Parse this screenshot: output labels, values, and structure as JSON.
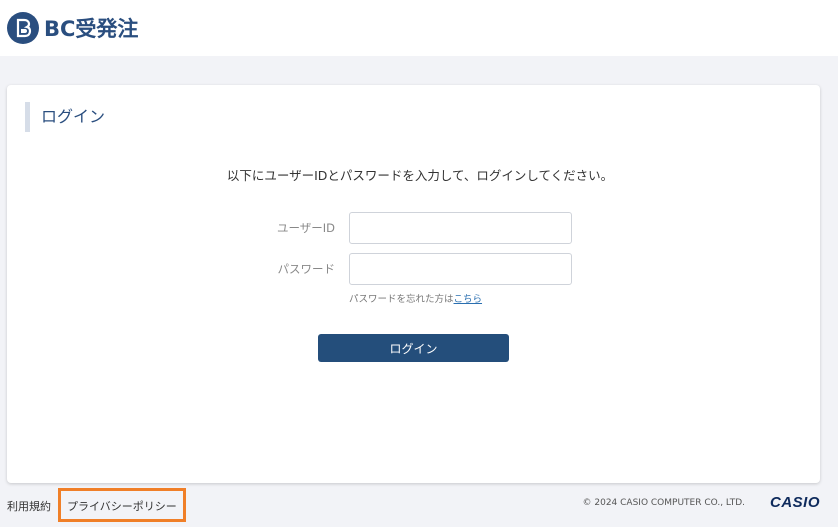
{
  "header": {
    "app_name": "BC受発注",
    "logo_mark": "b"
  },
  "login": {
    "section_title": "ログイン",
    "instruction": "以下にユーザーIDとパスワードを入力して、ログインしてください。",
    "user_id_label": "ユーザーID",
    "user_id_value": "",
    "password_label": "パスワード",
    "password_value": "",
    "forgot_prefix": "パスワードを忘れた方は",
    "forgot_link": "こちら",
    "submit_label": "ログイン"
  },
  "footer": {
    "terms_label": "利用規約",
    "privacy_label": "プライバシーポリシー",
    "copyright": "© 2024 CASIO COMPUTER CO., LTD.",
    "brand": "CASIO"
  },
  "colors": {
    "brand": "#2a4e7f",
    "button": "#244e7b",
    "highlight": "#f07f28",
    "background": "#f2f3f7"
  }
}
